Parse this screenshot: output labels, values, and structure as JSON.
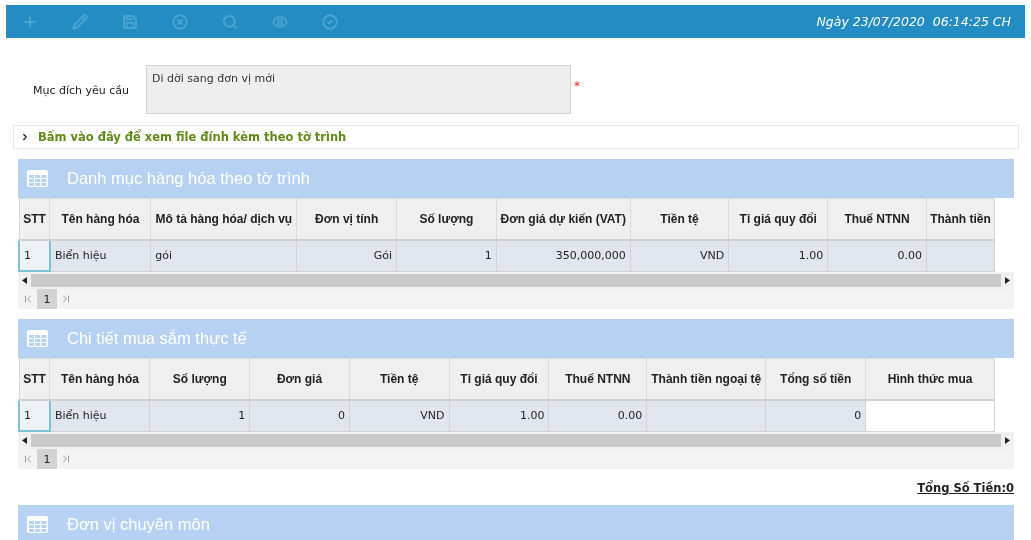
{
  "toolbar": {
    "tools": [
      {
        "kind": "add",
        "disabled": true
      },
      {
        "kind": "edit",
        "disabled": true
      },
      {
        "kind": "save",
        "disabled": true
      },
      {
        "kind": "cancel",
        "disabled": true
      },
      {
        "kind": "search",
        "disabled": true
      },
      {
        "kind": "view",
        "disabled": true
      },
      {
        "kind": "approve",
        "disabled": true
      }
    ],
    "date": "Ngày 23/07/2020",
    "time": "06:14:25 CH"
  },
  "form": {
    "label": "Mục đích yêu cầu",
    "value": "Di dời sang đơn vị mới",
    "required_mark": "*"
  },
  "attachment_link": "Bấm vào đây để xem file đính kèm theo tờ trình",
  "sections": [
    {
      "title": "Danh mục hàng hóa theo tờ trình",
      "table": {
        "columns": [
          "STT",
          "Tên hàng hóa",
          "Mô tả hàng hóa/ dịch vụ",
          "Đơn vị tính",
          "Số lượng",
          "Đơn giá dự kiến (VAT)",
          "Tiền tệ",
          "Tỉ giá quy đổi",
          "Thuế NTNN",
          "Thành tiền"
        ],
        "rows": [
          {
            "selected": true,
            "cells": [
              {
                "kind": "text",
                "text": "1"
              },
              {
                "kind": "text",
                "text": "Biển hiệu"
              },
              {
                "kind": "text",
                "text": "gói"
              },
              {
                "kind": "text",
                "text": "Gói"
              },
              {
                "kind": "text",
                "text": "1"
              },
              {
                "kind": "text",
                "text": "350,000,000"
              },
              {
                "kind": "text",
                "text": "VND"
              },
              {
                "kind": "text",
                "text": "1.00"
              },
              {
                "kind": "text",
                "text": "0.00"
              },
              {
                "kind": "text"
              }
            ]
          }
        ],
        "pages": [
          {
            "label": "1",
            "selected": true
          }
        ]
      }
    },
    {
      "title": "Chi tiết mua sắm thực tế",
      "table": {
        "columns": [
          "STT",
          "Tên hàng hóa",
          "Số lượng",
          "Đơn giá",
          "Tiền tệ",
          "Tỉ giá quy đổi",
          "Thuế NTNN",
          "Thành tiền ngoại tệ",
          "Tổng số tiền",
          "Hình thức mua"
        ],
        "rows": [
          {
            "selected": true,
            "cells": [
              {
                "kind": "text",
                "text": "1"
              },
              {
                "kind": "text",
                "text": "Biển hiệu"
              },
              {
                "kind": "text",
                "text": "1"
              },
              {
                "kind": "text",
                "text": "0"
              },
              {
                "kind": "text",
                "text": "VND"
              },
              {
                "kind": "text",
                "text": "1.00"
              },
              {
                "kind": "text",
                "text": "0.00"
              },
              {
                "kind": "text"
              },
              {
                "kind": "text",
                "text": "0"
              },
              {
                "kind": "input"
              }
            ]
          }
        ],
        "pages": [
          {
            "label": "1",
            "selected": true
          }
        ]
      },
      "total": "Tổng Số Tiền:0"
    },
    {
      "title": "Đơn vị chuyên môn"
    }
  ]
}
